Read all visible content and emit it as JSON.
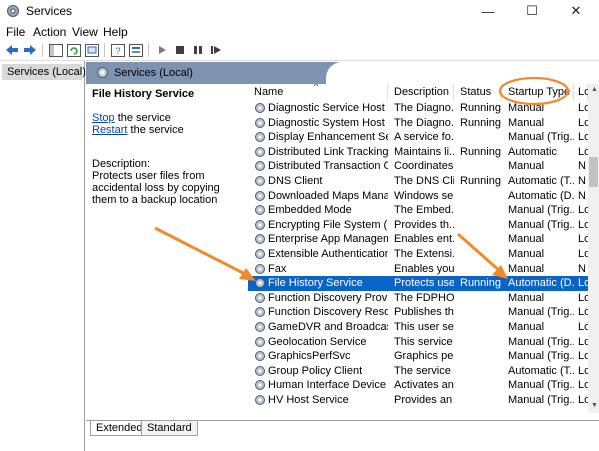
{
  "window": {
    "title": "Services",
    "minimize": "—",
    "maximize": "☐",
    "close": "✕"
  },
  "menu": [
    "File",
    "Action",
    "View",
    "Help"
  ],
  "toolbar": [
    "back-icon",
    "forward-icon",
    "console-tree-icon",
    "refresh-icon",
    "export-icon",
    "help-icon",
    "properties-icon",
    "start-icon",
    "stop-icon",
    "pause-icon",
    "restart-icon"
  ],
  "tree": {
    "item": "Services (Local)"
  },
  "pane": {
    "title": "Services (Local)"
  },
  "details": {
    "service_name": "File History Service",
    "stop_link": "Stop",
    "stop_suffix": " the service",
    "restart_link": "Restart",
    "restart_suffix": " the service",
    "description_label": "Description:",
    "description_text": "Protects user files from accidental loss by copying them to a backup location"
  },
  "columns": [
    "Name",
    "Description",
    "Status",
    "Startup Type",
    "Lo"
  ],
  "services": [
    {
      "name": "Diagnostic Service Host",
      "desc": "The Diagno...",
      "status": "Running",
      "startup": "Manual",
      "logon": "Lo"
    },
    {
      "name": "Diagnostic System Host",
      "desc": "The Diagno...",
      "status": "Running",
      "startup": "Manual",
      "logon": "Lo"
    },
    {
      "name": "Display Enhancement Service",
      "desc": "A service fo...",
      "status": "",
      "startup": "Manual (Trig...",
      "logon": "Lo"
    },
    {
      "name": "Distributed Link Tracking Cl...",
      "desc": "Maintains li...",
      "status": "Running",
      "startup": "Automatic",
      "logon": "Lo"
    },
    {
      "name": "Distributed Transaction Coo...",
      "desc": "Coordinates...",
      "status": "",
      "startup": "Manual",
      "logon": "N"
    },
    {
      "name": "DNS Client",
      "desc": "The DNS Cli...",
      "status": "Running",
      "startup": "Automatic (T...",
      "logon": "N"
    },
    {
      "name": "Downloaded Maps Manager",
      "desc": "Windows se...",
      "status": "",
      "startup": "Automatic (D...",
      "logon": "N"
    },
    {
      "name": "Embedded Mode",
      "desc": "The Embed...",
      "status": "",
      "startup": "Manual (Trig...",
      "logon": "Lo"
    },
    {
      "name": "Encrypting File System (EFS)",
      "desc": "Provides th...",
      "status": "",
      "startup": "Manual (Trig...",
      "logon": "Lo"
    },
    {
      "name": "Enterprise App Managemen...",
      "desc": "Enables ent...",
      "status": "",
      "startup": "Manual",
      "logon": "Lo"
    },
    {
      "name": "Extensible Authentication P...",
      "desc": "The Extensi...",
      "status": "",
      "startup": "Manual",
      "logon": "Lo"
    },
    {
      "name": "Fax",
      "desc": "Enables you...",
      "status": "",
      "startup": "Manual",
      "logon": "N"
    },
    {
      "name": "File History Service",
      "desc": "Protects use...",
      "status": "Running",
      "startup": "Automatic (D...",
      "logon": "Lo",
      "selected": true
    },
    {
      "name": "Function Discovery Provide...",
      "desc": "The FDPHO...",
      "status": "",
      "startup": "Manual",
      "logon": "Lo"
    },
    {
      "name": "Function Discovery Resourc...",
      "desc": "Publishes th...",
      "status": "",
      "startup": "Manual (Trig...",
      "logon": "Lo"
    },
    {
      "name": "GameDVR and Broadcast Us...",
      "desc": "This user se...",
      "status": "",
      "startup": "Manual",
      "logon": "Lo"
    },
    {
      "name": "Geolocation Service",
      "desc": "This service ...",
      "status": "",
      "startup": "Manual (Trig...",
      "logon": "Lo"
    },
    {
      "name": "GraphicsPerfSvc",
      "desc": "Graphics pe...",
      "status": "",
      "startup": "Manual (Trig...",
      "logon": "Lo"
    },
    {
      "name": "Group Policy Client",
      "desc": "The service ...",
      "status": "",
      "startup": "Automatic (T...",
      "logon": "Lo"
    },
    {
      "name": "Human Interface Device Ser...",
      "desc": "Activates an...",
      "status": "",
      "startup": "Manual (Trig...",
      "logon": "Lo"
    },
    {
      "name": "HV Host Service",
      "desc": "Provides an ...",
      "status": "",
      "startup": "Manual (Trig...",
      "logon": "Lo"
    }
  ],
  "tabs": {
    "extended": "Extended",
    "standard": "Standard"
  },
  "colors": {
    "selection": "#0a64c8",
    "header": "#7d93b0",
    "annotation": "#f08a2a"
  }
}
